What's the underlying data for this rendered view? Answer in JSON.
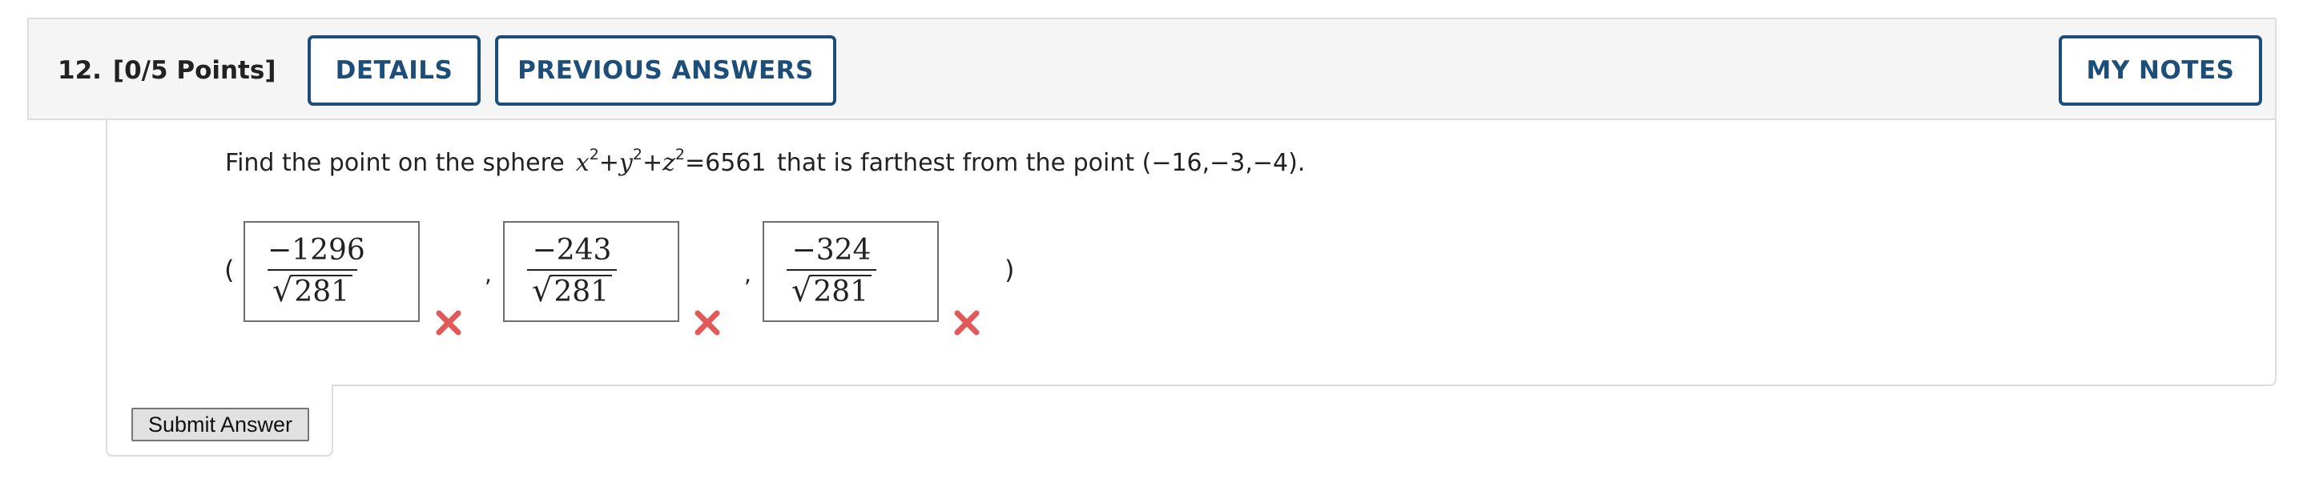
{
  "question": {
    "number": "12.",
    "points": "[0/5 Points]",
    "buttons": {
      "details": "DETAILS",
      "previous_answers": "PREVIOUS ANSWERS",
      "my_notes": "MY NOTES"
    },
    "prompt": {
      "before": "Find the point on the sphere",
      "eq_rhs": "=6561",
      "after": "that is farthest from the point (−16,−3,−4)."
    },
    "answers": [
      {
        "numerator": "−1296",
        "denominator": "281",
        "status": "incorrect"
      },
      {
        "numerator": "−243",
        "denominator": "281",
        "status": "incorrect"
      },
      {
        "numerator": "−324",
        "denominator": "281",
        "status": "incorrect"
      }
    ],
    "open_paren": "(",
    "close_paren": ")",
    "separator": ",",
    "submit_label": "Submit Answer"
  },
  "colors": {
    "accent": "#1d4e7a",
    "incorrect": "#e05a5a",
    "header_bg": "#f5f5f5"
  },
  "icons": {
    "incorrect": "x-mark-icon"
  }
}
